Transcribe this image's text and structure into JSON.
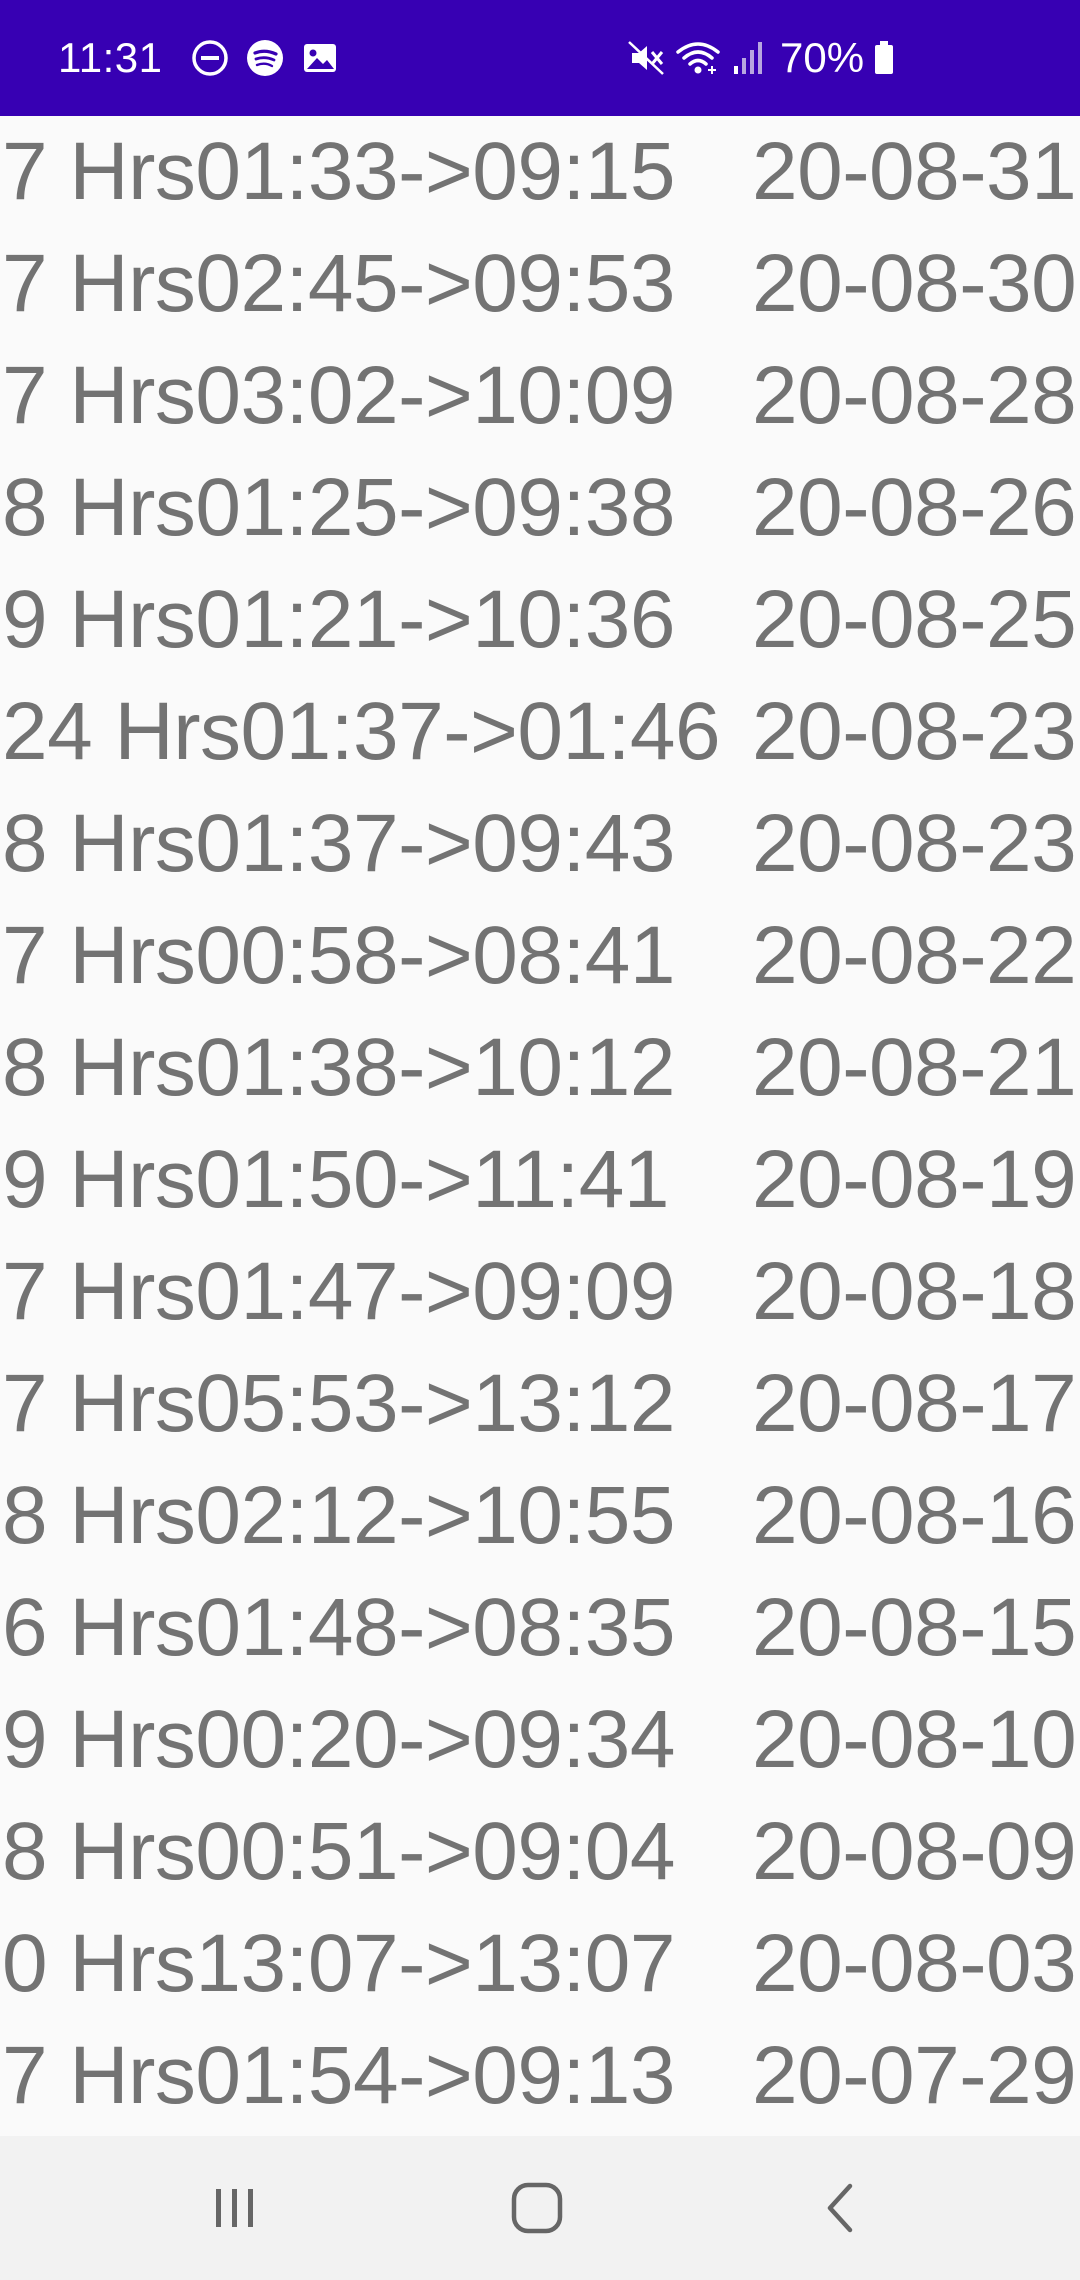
{
  "status_bar": {
    "time": "11:31",
    "battery": "70%",
    "icons_left": [
      "do-not-disturb-icon",
      "spotify-icon",
      "gallery-icon"
    ],
    "icons_right": [
      "mute-icon",
      "wifi-icon",
      "signal-icon",
      "battery-icon"
    ],
    "background": "#3700b3"
  },
  "rows": [
    {
      "duration": "7 Hrs01:33->09:15",
      "date": "20-08-31"
    },
    {
      "duration": "7 Hrs02:45->09:53",
      "date": "20-08-30"
    },
    {
      "duration": "7 Hrs03:02->10:09",
      "date": "20-08-28"
    },
    {
      "duration": "8 Hrs01:25->09:38",
      "date": "20-08-26"
    },
    {
      "duration": "9 Hrs01:21->10:36",
      "date": "20-08-25"
    },
    {
      "duration": "24 Hrs01:37->01:46",
      "date": "20-08-23"
    },
    {
      "duration": "8 Hrs01:37->09:43",
      "date": "20-08-23"
    },
    {
      "duration": "7 Hrs00:58->08:41",
      "date": "20-08-22"
    },
    {
      "duration": "8 Hrs01:38->10:12",
      "date": "20-08-21"
    },
    {
      "duration": "9 Hrs01:50->11:41",
      "date": "20-08-19"
    },
    {
      "duration": "7 Hrs01:47->09:09",
      "date": "20-08-18"
    },
    {
      "duration": "7 Hrs05:53->13:12",
      "date": "20-08-17"
    },
    {
      "duration": "8 Hrs02:12->10:55",
      "date": "20-08-16"
    },
    {
      "duration": "6 Hrs01:48->08:35",
      "date": "20-08-15"
    },
    {
      "duration": "9 Hrs00:20->09:34",
      "date": "20-08-10"
    },
    {
      "duration": "8 Hrs00:51->09:04",
      "date": "20-08-09"
    },
    {
      "duration": "0 Hrs13:07->13:07",
      "date": "20-08-03"
    },
    {
      "duration": "7 Hrs01:54->09:13",
      "date": "20-07-29"
    }
  ],
  "nav_bar": {
    "buttons": [
      "recent-apps-icon",
      "home-icon",
      "back-icon"
    ]
  },
  "colors": {
    "text": "#737373",
    "list_background": "#fafafa",
    "nav_background": "#f2f2f2"
  }
}
